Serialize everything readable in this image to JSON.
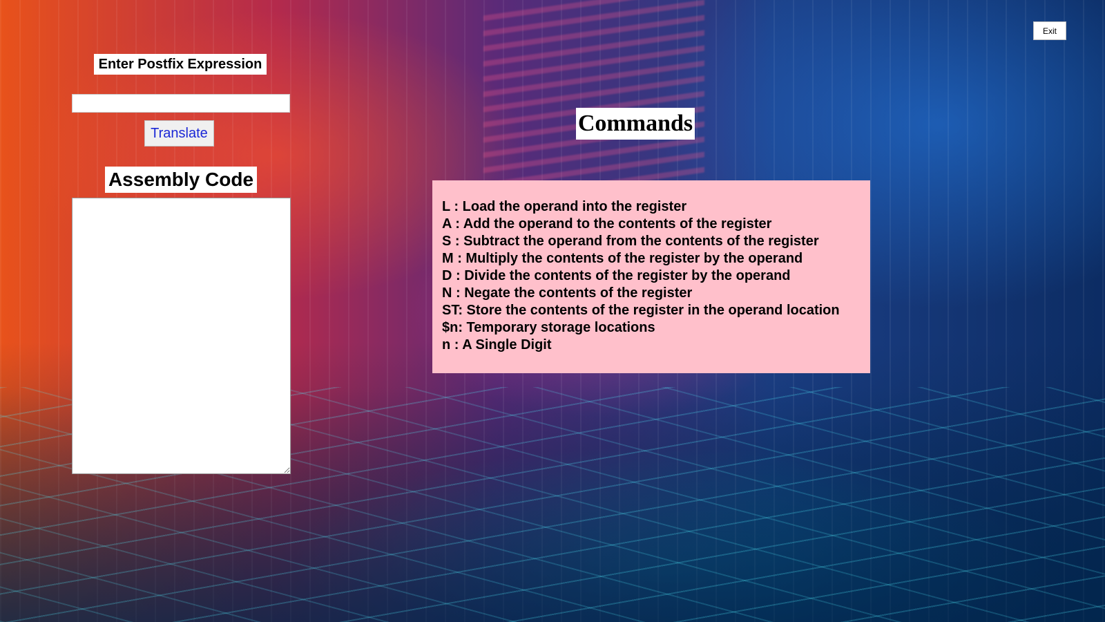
{
  "window": {
    "exit_label": "Exit"
  },
  "input_section": {
    "label": "Enter Postfix Expression",
    "value": "",
    "placeholder": ""
  },
  "translate_button": {
    "label": "Translate"
  },
  "output_section": {
    "label": "Assembly Code",
    "value": ""
  },
  "commands": {
    "title": "Commands",
    "items": [
      "L : Load the operand into the register",
      "A : Add the operand to the contents of the register",
      "S : Subtract the operand from the contents of the register",
      "M : Multiply the contents of the register by the operand",
      "D : Divide the contents of the register by the operand",
      "N : Negate the contents of the register",
      "ST: Store the contents of the register in the operand location",
      "$n: Temporary storage locations",
      "n : A Single Digit"
    ]
  },
  "colors": {
    "commands_background": "#ffc0cb",
    "translate_text": "#1a27d6"
  }
}
